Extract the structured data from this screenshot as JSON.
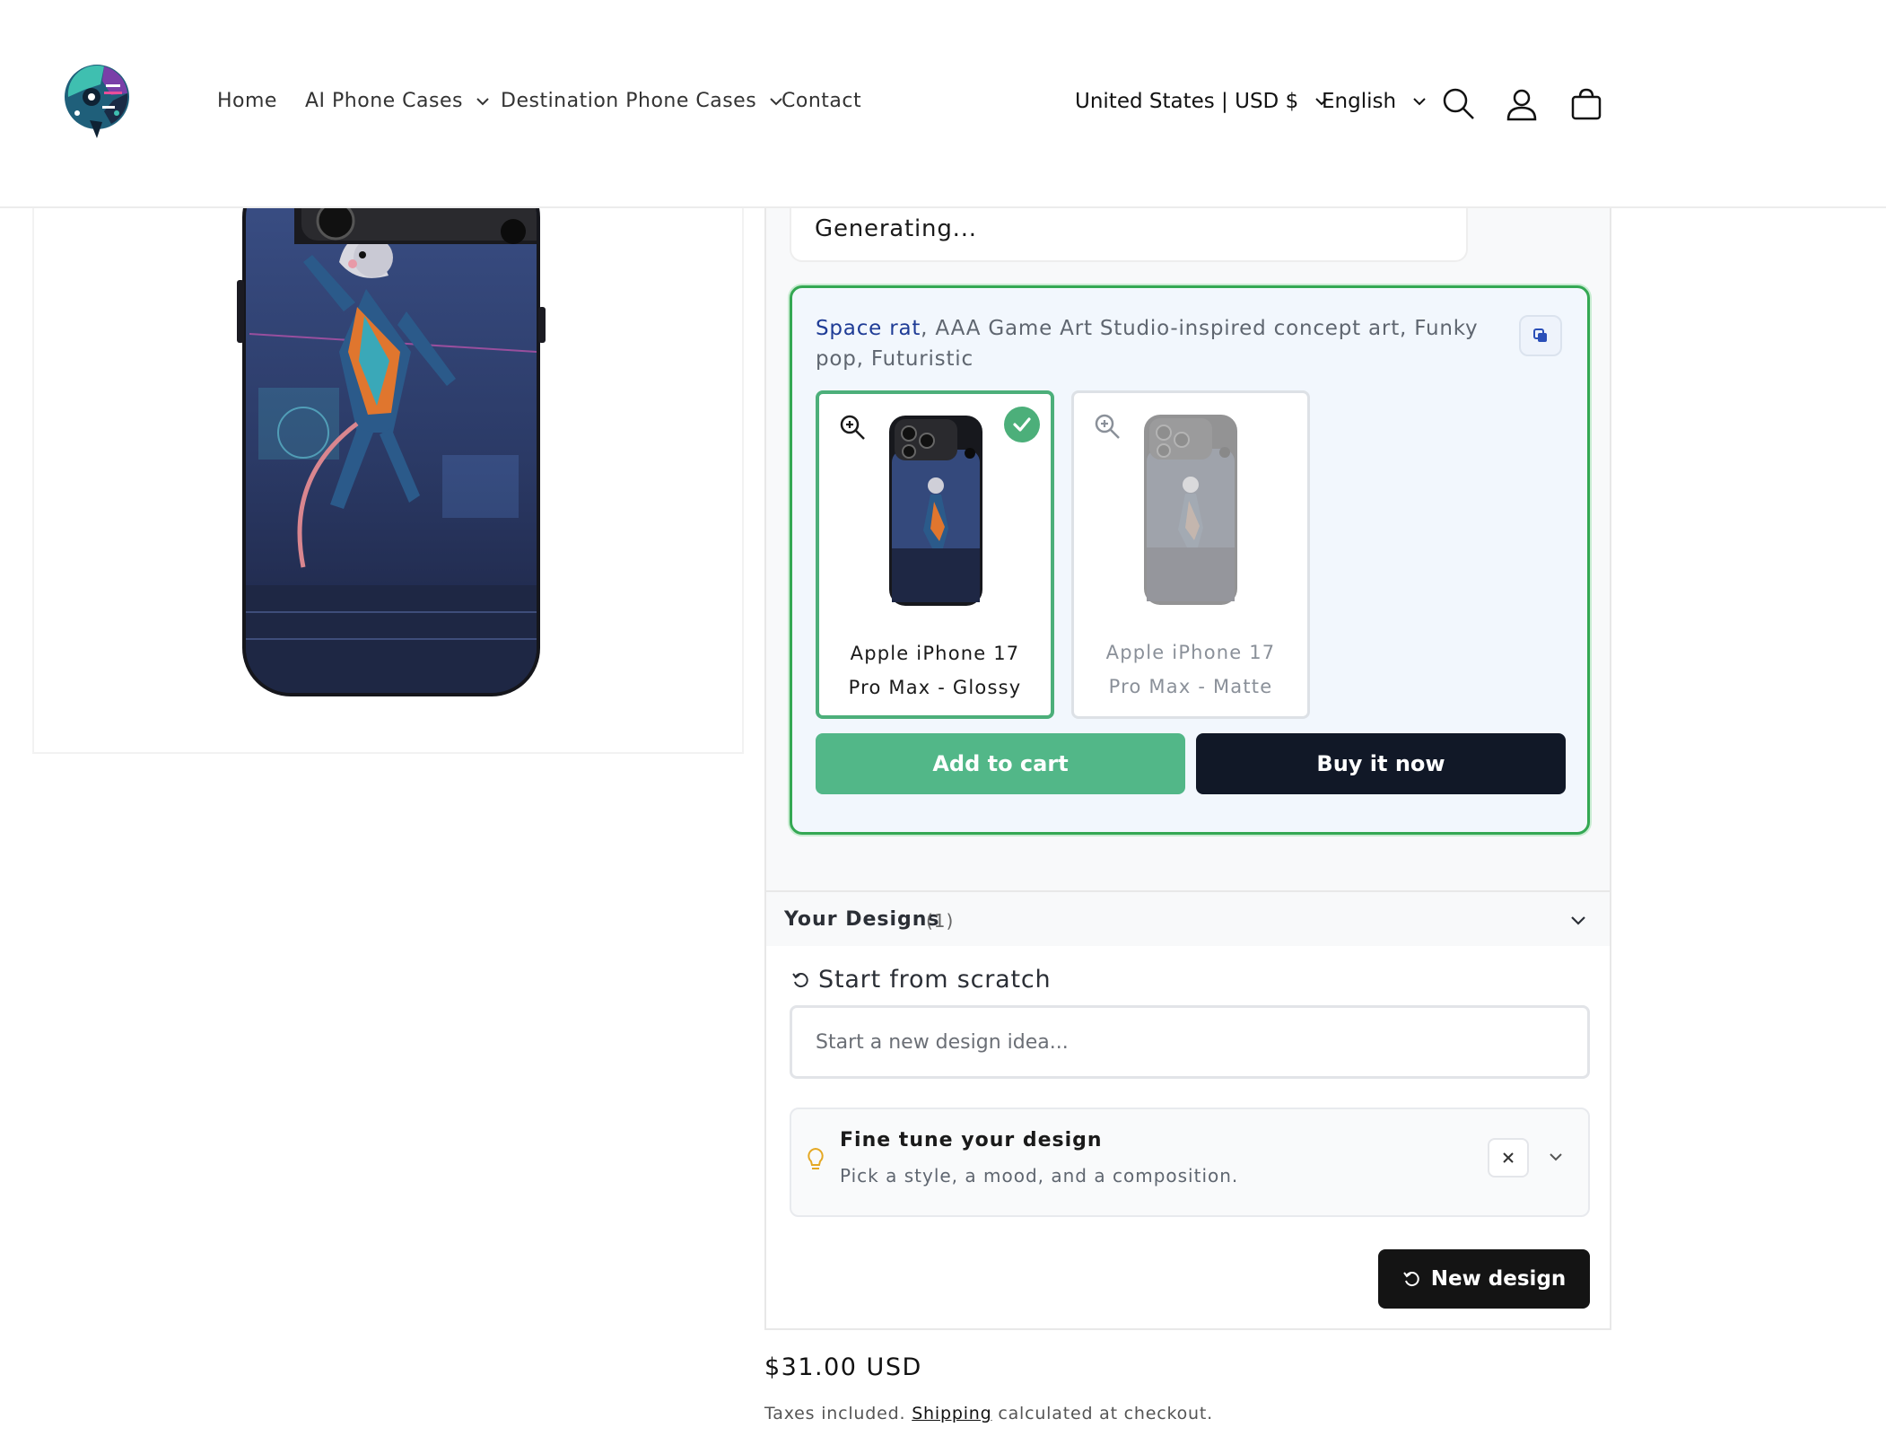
{
  "header": {
    "nav": [
      {
        "label": "Home",
        "has_dropdown": false
      },
      {
        "label": "AI Phone Cases",
        "has_dropdown": true
      },
      {
        "label": "Destination Phone Cases",
        "has_dropdown": true
      },
      {
        "label": "Contact",
        "has_dropdown": false
      }
    ],
    "country": "United States | USD $",
    "language": "English",
    "icons": [
      "search-icon",
      "account-icon",
      "cart-icon"
    ]
  },
  "builder": {
    "status": "Generating...",
    "prompt_accent": "Space rat",
    "prompt_rest": ", AAA Game Art Studio-inspired concept art, Funky pop, Futuristic",
    "variants": [
      {
        "label": "Apple iPhone 17 Pro Max - Glossy",
        "selected": true
      },
      {
        "label": "Apple iPhone 17 Pro Max - Matte",
        "selected": false
      }
    ],
    "add_to_cart": "Add to cart",
    "buy_now": "Buy it now",
    "designs_title": "Your Designs",
    "designs_count": "(1)",
    "scratch_label": "Start from scratch",
    "scratch_placeholder": "Start a new design idea...",
    "tune_title": "Fine tune your design",
    "tune_sub": "Pick a style, a mood, and a composition.",
    "new_design": "New design"
  },
  "product": {
    "price": "$31.00 USD",
    "tax_prefix": "Taxes included.",
    "shipping_link": "Shipping",
    "tax_suffix": "calculated at checkout."
  },
  "colors": {
    "accent_green": "#52b788",
    "selected_border": "#34a853",
    "dark_button": "#111827",
    "prompt_accent": "#1f3c96"
  }
}
